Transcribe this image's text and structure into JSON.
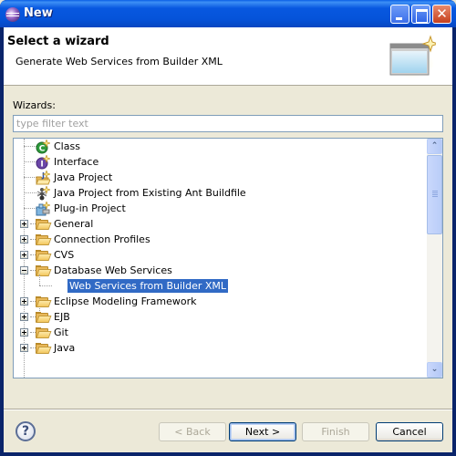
{
  "window": {
    "title": "New",
    "controls": {
      "minimize": "minimize",
      "maximize": "maximize",
      "close": "✕"
    }
  },
  "header": {
    "title": "Select a wizard",
    "description": "Generate Web Services from Builder XML"
  },
  "wizards_label": "Wizards:",
  "filter": {
    "value": "",
    "placeholder": "type filter text"
  },
  "tree": {
    "items": [
      {
        "label": "Class",
        "icon": "class-icon",
        "level": 1,
        "expander": "none"
      },
      {
        "label": "Interface",
        "icon": "interface-icon",
        "level": 1,
        "expander": "none"
      },
      {
        "label": "Java Project",
        "icon": "java-project-icon",
        "level": 1,
        "expander": "none"
      },
      {
        "label": "Java Project from Existing Ant Buildfile",
        "icon": "ant-icon",
        "level": 1,
        "expander": "none"
      },
      {
        "label": "Plug-in Project",
        "icon": "plugin-project-icon",
        "level": 1,
        "expander": "none"
      },
      {
        "label": "General",
        "icon": "folder-icon",
        "level": 0,
        "expander": "collapsed"
      },
      {
        "label": "Connection Profiles",
        "icon": "folder-icon",
        "level": 0,
        "expander": "collapsed"
      },
      {
        "label": "CVS",
        "icon": "folder-icon",
        "level": 0,
        "expander": "collapsed"
      },
      {
        "label": "Database Web Services",
        "icon": "folder-icon",
        "level": 0,
        "expander": "expanded"
      },
      {
        "label": "Web Services from Builder XML",
        "icon": "none",
        "level": 1,
        "expander": "none",
        "selected": true
      },
      {
        "label": "Eclipse Modeling Framework",
        "icon": "folder-icon",
        "level": 0,
        "expander": "collapsed"
      },
      {
        "label": "EJB",
        "icon": "folder-icon",
        "level": 0,
        "expander": "collapsed"
      },
      {
        "label": "Git",
        "icon": "folder-icon",
        "level": 0,
        "expander": "collapsed"
      },
      {
        "label": "Java",
        "icon": "folder-icon",
        "level": 0,
        "expander": "collapsed"
      }
    ]
  },
  "buttons": {
    "help": "?",
    "back": "< Back",
    "next": "Next >",
    "finish": "Finish",
    "cancel": "Cancel"
  },
  "colors": {
    "selection": "#316ac5",
    "titlebar": "#0553d9",
    "dialog_bg": "#ece9d8"
  }
}
